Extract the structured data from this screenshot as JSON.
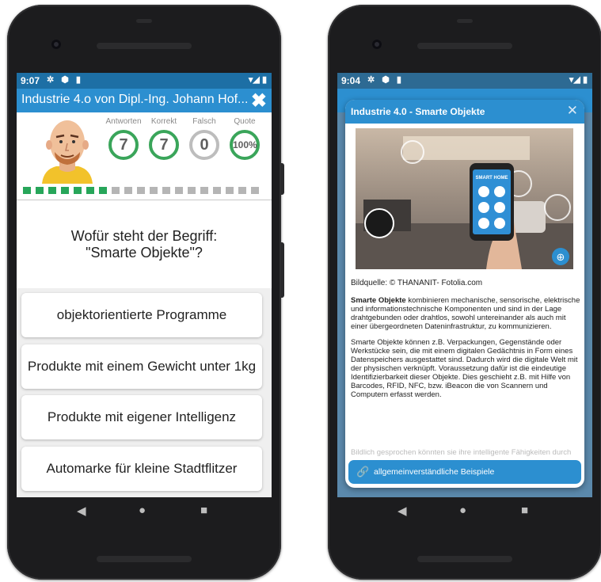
{
  "left": {
    "status": {
      "time": "9:07",
      "left_icons": "✲ ⬢ ▮",
      "right_icons": "▾◢ ▮"
    },
    "title": "Industrie 4.o von Dipl.-Ing. Johann Hof...",
    "close_icon": "✖",
    "stats": [
      {
        "label": "Antworten",
        "value": "7",
        "color": "#3aa55a"
      },
      {
        "label": "Korrekt",
        "value": "7",
        "color": "#3aa55a"
      },
      {
        "label": "Falsch",
        "value": "0",
        "color": "#bdbdbd"
      },
      {
        "label": "Quote",
        "value": "100%",
        "color": "#3aa55a"
      }
    ],
    "progress": {
      "done": 7,
      "total": 19,
      "done_color": "#27a65a",
      "todo_color": "#b5b5b5"
    },
    "question_line1": "Wofür steht der Begriff:",
    "question_line2": "\"Smarte Objekte\"?",
    "answers": [
      "objektorientierte Programme",
      "Produkte mit einem Gewicht unter 1kg",
      "Produkte mit eigener Intelligenz",
      "Automarke für kleine Stadtflitzer"
    ]
  },
  "right": {
    "status": {
      "time": "9:04",
      "left_icons": "✲ ⬢ ▮",
      "right_icons": "▾◢ ▮"
    },
    "dialog_title": "Industrie 4.0 - Smarte Objekte",
    "close_icon": "✕",
    "image_badge": "SMART HOME",
    "zoom_icon": "⊕",
    "credit": "Bildquelle: © THANANIT- Fotolia.com",
    "para1_bold": "Smarte Objekte",
    "para1_rest": " kombinieren mechanische, sensorische, elektrische und informationstechnische Komponenten und sind in der Lage drahtgebunden oder drahtlos, sowohl untereinander als auch mit einer übergeordneten Dateninfrastruktur, zu kommunizieren.",
    "para2": "Smarte Objekte können z.B. Verpackungen, Gegenstände oder Werkstücke sein, die mit einem digitalen Gedächtnis in Form eines Datenspeichers ausgestattet sind. Dadurch wird die digitale Welt mit der physischen verknüpft. Voraussetzung dafür ist die eindeutige Identifizierbarkeit dieser Objekte. Dies geschieht z.B. mit Hilfe von Barcodes, RFID, NFC, bzw. iBeacon die von Scannern und Computern erfasst werden.",
    "para3_faded": "Bildlich gesprochen könnten sie ihre intelligente Fähigkeiten durch",
    "link_icon": "🔗",
    "button_label": "allgemeinverständliche Beispiele"
  },
  "nav": {
    "back": "◀",
    "home": "●",
    "recents": "■"
  }
}
